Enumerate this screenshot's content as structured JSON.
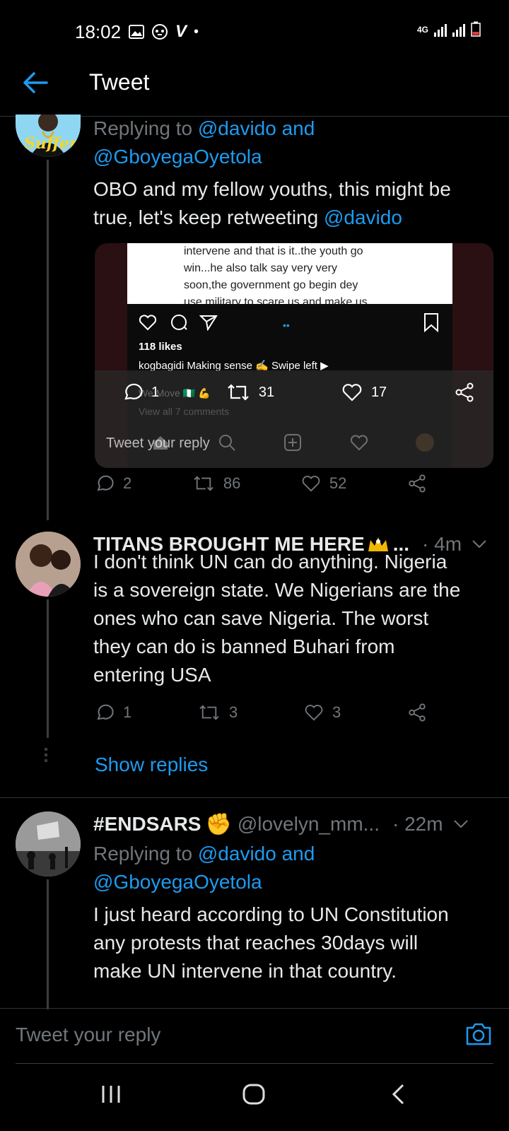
{
  "status_bar": {
    "time": "18:02",
    "network": "4G",
    "icons": [
      "image-icon",
      "game-icon",
      "v-icon",
      "dot-icon"
    ]
  },
  "header": {
    "title": "Tweet"
  },
  "tweet1": {
    "reply_prefix": "Replying to",
    "reply_to_line1": "@davido and",
    "reply_to_line2": "@GboyegaOyetola",
    "text_line1": "OBO and my fellow youths, this might be",
    "text_line2": "true, let's keep retweeting",
    "mention": "@davido",
    "avatar_text": "Suffer",
    "screenshot": {
      "caption_line1": "intervene and that is it..the youth go",
      "caption_line2": "win...he also talk say very very",
      "caption_line3": "soon,the government go begin dey",
      "caption_line4": "use military to scare us and make us",
      "likes": "118 likes",
      "post_line": "kogbagidi Making sense ✍️ Swipe left ▶",
      "move_line": "We Move 🇳🇬 💪",
      "view_comments": "View all 7 comments",
      "overlay_replies": "1",
      "overlay_retweets": "31",
      "overlay_likes": "17",
      "overlay_reply_placeholder": "Tweet your reply"
    },
    "replies": "2",
    "retweets": "86",
    "likes": "52"
  },
  "tweet2": {
    "name": "TITANS BROUGHT ME HERE",
    "name_suffix": "...",
    "time": "· 4m",
    "text_lines": [
      "I don't think UN can do anything. Nigeria",
      "is a sovereign state. We Nigerians are the",
      "ones who can save Nigeria. The worst",
      "they can do is banned Buhari from",
      "entering USA"
    ],
    "replies": "1",
    "retweets": "3",
    "likes": "3",
    "show_replies": "Show replies"
  },
  "tweet3": {
    "name": "#ENDSARS",
    "handle": "@lovelyn_mm...",
    "time": "· 22m",
    "reply_prefix": "Replying to",
    "reply_to_line1": "@davido and",
    "reply_to_line2": "@GboyegaOyetola",
    "text_lines": [
      "I just heard according to UN Constitution",
      "any protests that reaches 30days will",
      "make UN intervene in that country."
    ]
  },
  "compose": {
    "placeholder": "Tweet your reply"
  },
  "colors": {
    "accent": "#1d9bf0",
    "background": "#000000",
    "muted": "#71767b"
  }
}
